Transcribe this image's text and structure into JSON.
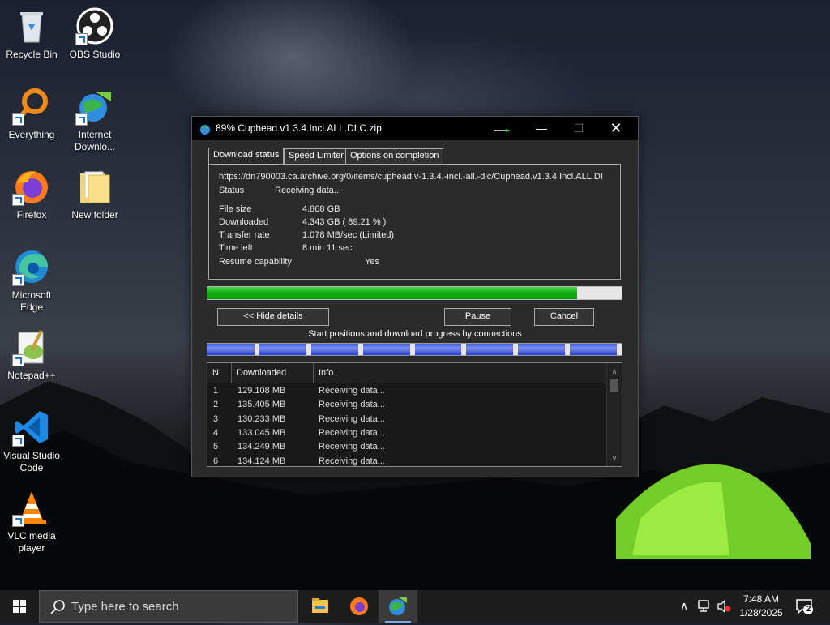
{
  "desktop": {
    "icons": [
      {
        "label": "Recycle Bin"
      },
      {
        "label": "OBS Studio"
      },
      {
        "label": "Everything"
      },
      {
        "label": "Internet Downlo..."
      },
      {
        "label": "Firefox"
      },
      {
        "label": "New folder"
      },
      {
        "label": "Microsoft Edge"
      },
      {
        "label": "Notepad++"
      },
      {
        "label": "Visual Studio Code"
      },
      {
        "label": "VLC media player"
      }
    ]
  },
  "window": {
    "title": "89% Cuphead.v1.3.4.Incl.ALL.DLC.zip",
    "tabs": [
      "Download status",
      "Speed Limiter",
      "Options on completion"
    ],
    "url": "https://dn790003.ca.archive.org/0/items/cuphead.v-1.3.4.-incl.-all.-dlc/Cuphead.v1.3.4.Incl.ALL.DI",
    "status_label": "Status",
    "status_value": "Receiving data...",
    "file_size_label": "File size",
    "file_size_value": "4.868  GB",
    "downloaded_label": "Downloaded",
    "downloaded_value": "4.343  GB  ( 89.21 % )",
    "transfer_rate_label": "Transfer rate",
    "transfer_rate_value": "1.078  MB/sec  (Limited)",
    "time_left_label": "Time left",
    "time_left_value": "8 min 11 sec",
    "resume_label": "Resume capability",
    "resume_value": "Yes",
    "progress_percent": 89.21,
    "buttons": {
      "hide_details": "<< Hide details",
      "pause": "Pause",
      "cancel": "Cancel"
    },
    "connections_caption": "Start positions and download progress by connections",
    "connection_count": 8,
    "table": {
      "headers": [
        "N.",
        "Downloaded",
        "Info"
      ],
      "rows": [
        {
          "n": "1",
          "downloaded": "129.108  MB",
          "info": "Receiving data..."
        },
        {
          "n": "2",
          "downloaded": "135.405  MB",
          "info": "Receiving data..."
        },
        {
          "n": "3",
          "downloaded": "130.233  MB",
          "info": "Receiving data..."
        },
        {
          "n": "4",
          "downloaded": "133.045  MB",
          "info": "Receiving data..."
        },
        {
          "n": "5",
          "downloaded": "134.249  MB",
          "info": "Receiving data..."
        },
        {
          "n": "6",
          "downloaded": "134.124  MB",
          "info": "Receiving data..."
        }
      ]
    }
  },
  "taskbar": {
    "search_placeholder": "Type here to search",
    "time": "7:48 AM",
    "date": "1/28/2025",
    "notification_count": "2"
  },
  "colors": {
    "progress_green": "#16b016",
    "connection_blue": "#2a5ad6",
    "window_bg": "#2b2b2b"
  }
}
